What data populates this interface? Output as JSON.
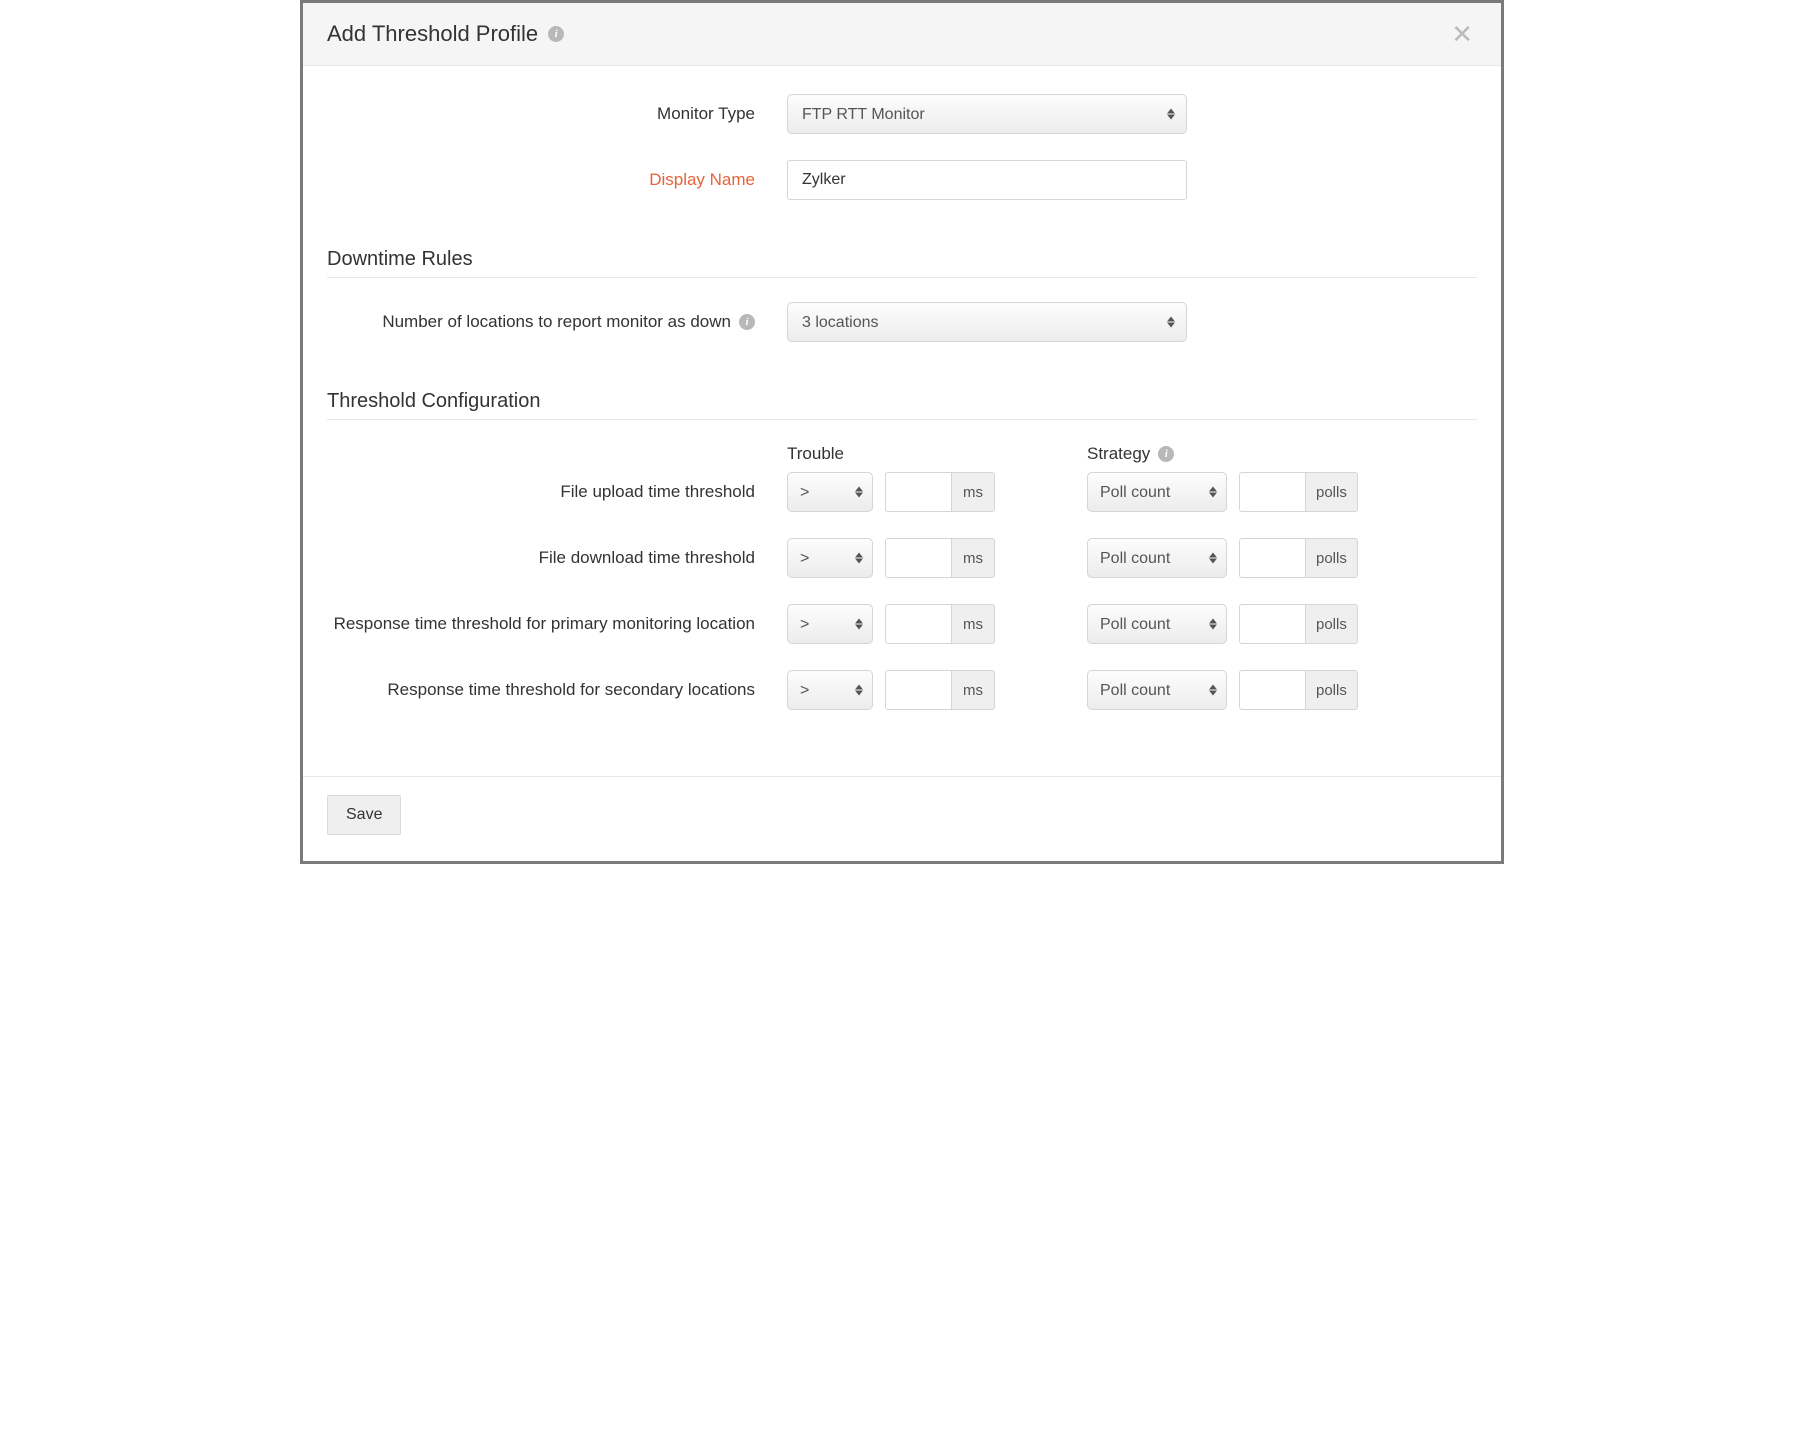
{
  "header": {
    "title": "Add Threshold Profile"
  },
  "fields": {
    "monitor_type": {
      "label": "Monitor Type",
      "value": "FTP RTT Monitor"
    },
    "display_name": {
      "label": "Display Name",
      "value": "Zylker",
      "placeholder": ""
    }
  },
  "sections": {
    "downtime": {
      "title": "Downtime Rules",
      "locations": {
        "label": "Number of locations to report monitor as down",
        "value": "3 locations"
      }
    },
    "threshold": {
      "title": "Threshold Configuration",
      "col_trouble": "Trouble",
      "col_strategy": "Strategy",
      "unit_ms": "ms",
      "unit_polls": "polls",
      "operator": ">",
      "strategy_option": "Poll count",
      "rows": [
        {
          "label": "File upload time threshold",
          "ms": "",
          "polls": ""
        },
        {
          "label": "File download time threshold",
          "ms": "",
          "polls": ""
        },
        {
          "label": "Response time threshold for primary monitoring location",
          "ms": "",
          "polls": ""
        },
        {
          "label": "Response time threshold for secondary locations",
          "ms": "",
          "polls": ""
        }
      ]
    }
  },
  "footer": {
    "save": "Save"
  }
}
